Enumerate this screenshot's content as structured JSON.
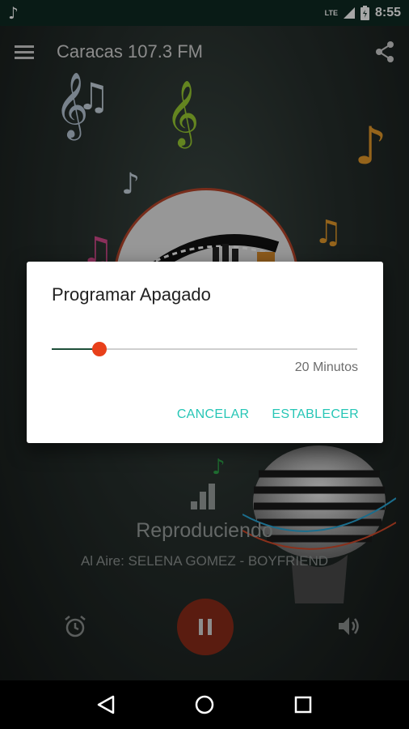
{
  "status_bar": {
    "time": "8:55",
    "network": "LTE"
  },
  "app_bar": {
    "title": "Caracas 107.3 FM"
  },
  "player": {
    "status": "Reproduciendo",
    "now_playing": "Al Aire: SELENA GOMEZ - BOYFRIEND"
  },
  "dialog": {
    "title": "Programar Apagado",
    "slider_fraction": 0.155,
    "value_text": "20 Minutos",
    "cancel_label": "CANCELAR",
    "confirm_label": "ESTABLECER"
  },
  "colors": {
    "accent": "#e8401a",
    "button_text": "#26c6b6",
    "pause_button": "#8a2c1a"
  }
}
